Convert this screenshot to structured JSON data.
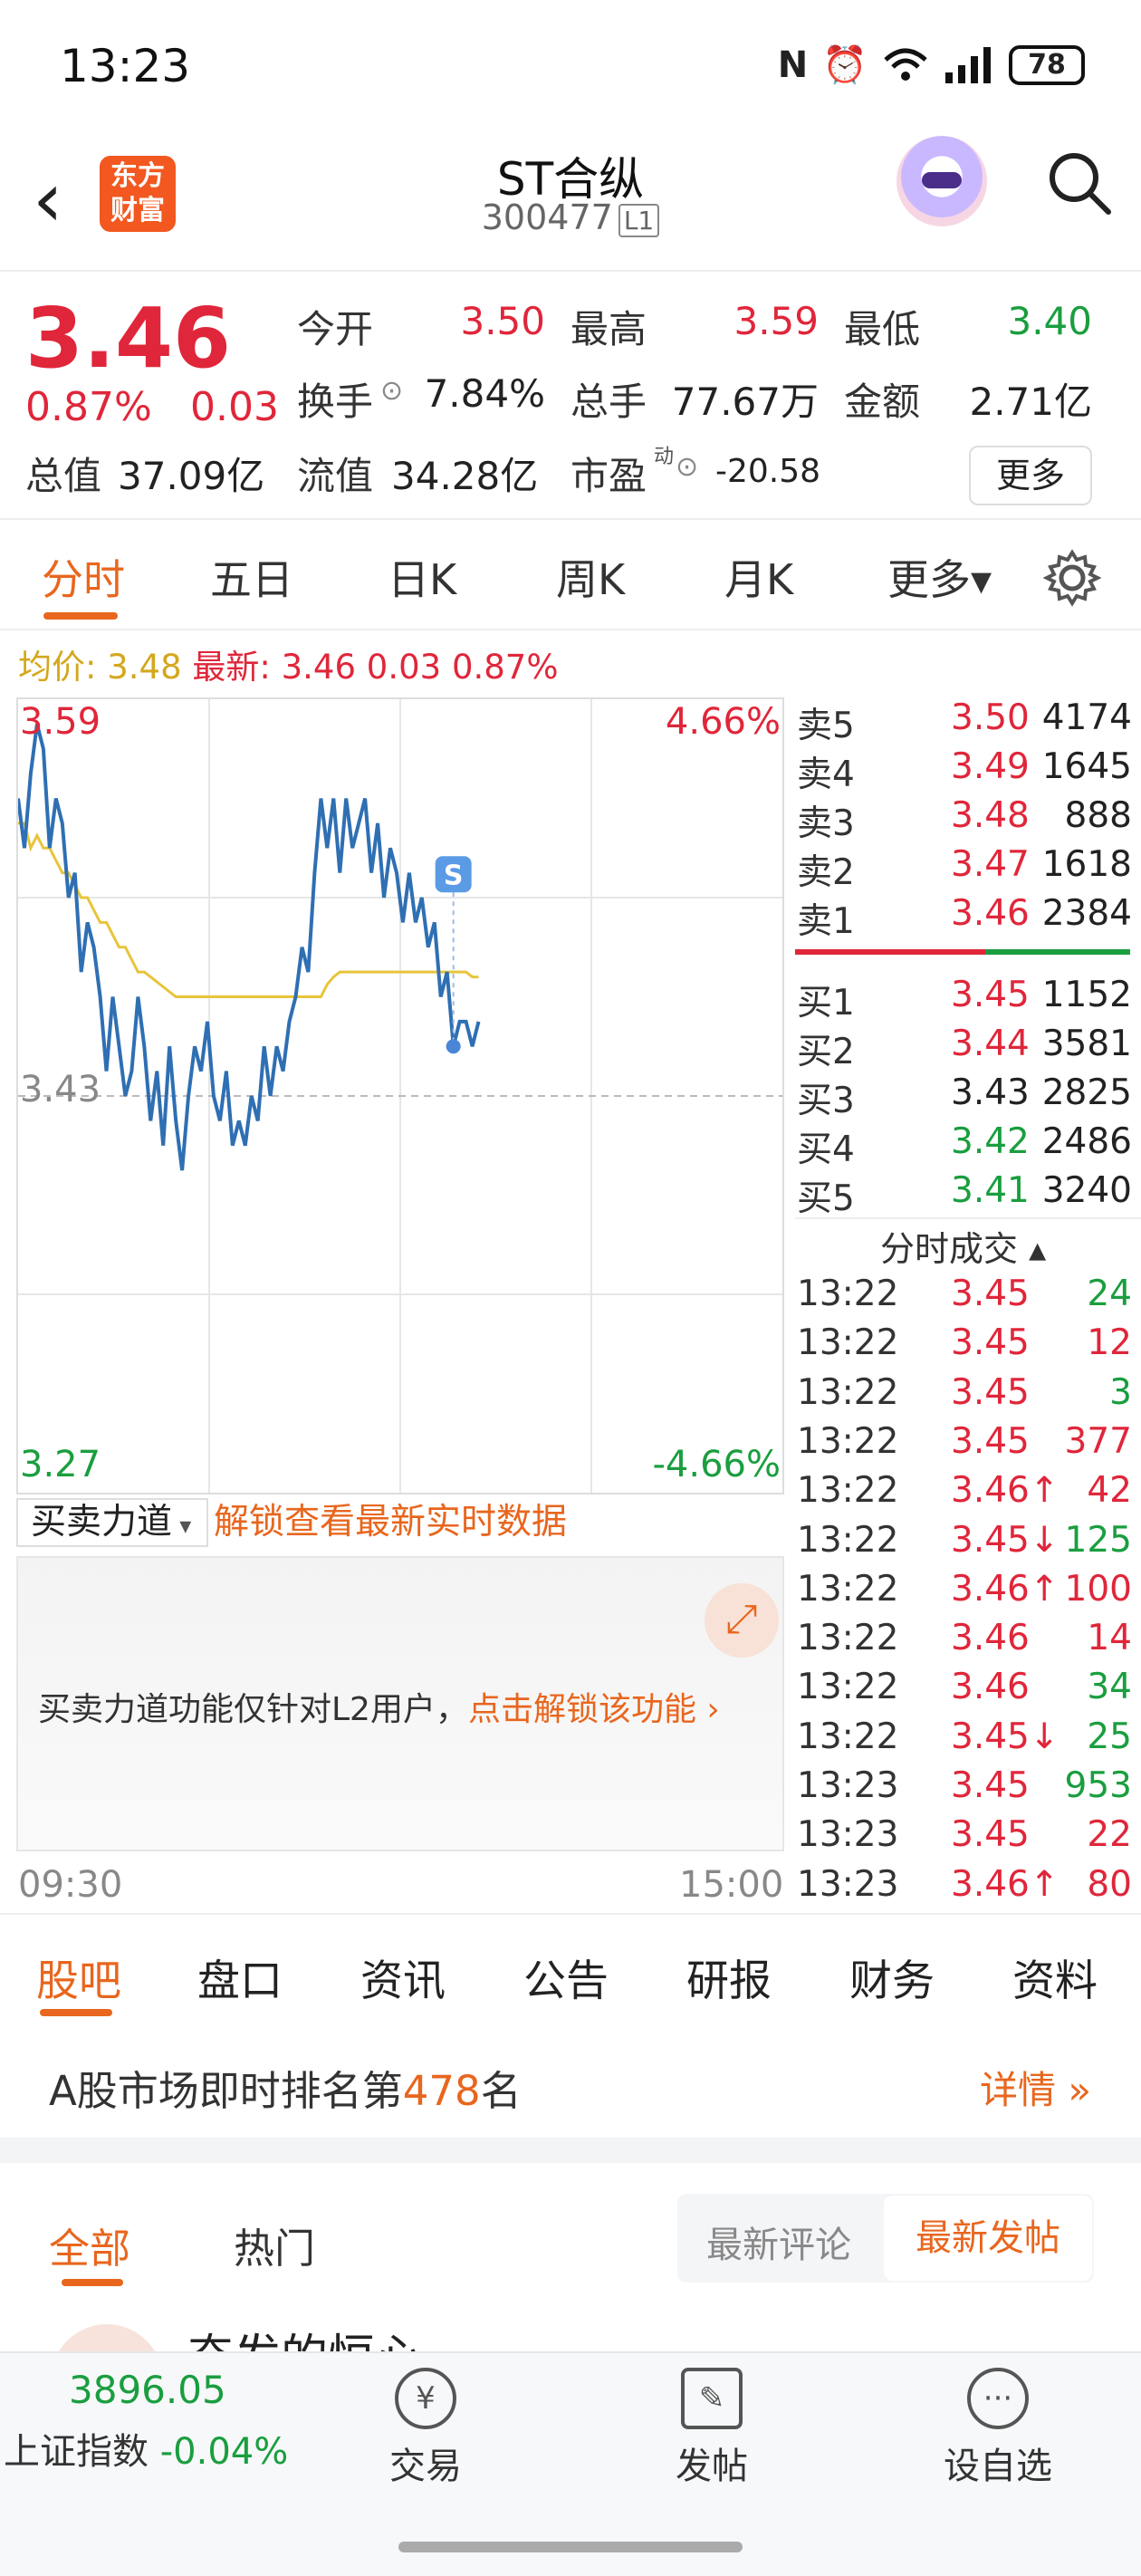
{
  "status_bar": {
    "time": "13:23",
    "battery": "78"
  },
  "header": {
    "title": "ST合纵",
    "code": "300477",
    "level": "L1",
    "logo_line1": "东方",
    "logo_line2": "财富"
  },
  "quote": {
    "price": "3.46",
    "pct": "0.87%",
    "chg": "0.03",
    "open_label": "今开",
    "open": "3.50",
    "high_label": "最高",
    "high": "3.59",
    "low_label": "最低",
    "low": "3.40",
    "turnover_label": "换手",
    "turnover": "7.84%",
    "volume_label": "总手",
    "volume": "77.67万",
    "amount_label": "金额",
    "amount": "2.71亿",
    "mktcap_label": "总值",
    "mktcap": "37.09亿",
    "float_label": "流值",
    "float": "34.28亿",
    "pe_label": "市盈",
    "pe_sup": "动",
    "pe": "-20.58",
    "more_button": "更多"
  },
  "chart_tabs": [
    "分时",
    "五日",
    "日K",
    "周K",
    "月K",
    "更多▾"
  ],
  "chart_info": {
    "avg_label": "均价:",
    "avg": "3.48",
    "last_label": "最新:",
    "last": "3.46",
    "last_chg": "0.03",
    "last_pct": "0.87%"
  },
  "chart_data": {
    "type": "line",
    "y_top": "3.59",
    "y_mid": "3.43",
    "y_bottom": "3.27",
    "pct_top": "4.66%",
    "pct_bottom": "-4.66%",
    "x_start": "09:30",
    "x_end": "15:00",
    "ylim": [
      3.27,
      3.59
    ],
    "prev_close": 3.43,
    "marker_label": "S",
    "series": [
      {
        "values": [
          3.55,
          3.53,
          3.56,
          3.58,
          3.57,
          3.53,
          3.55,
          3.54,
          3.51,
          3.52,
          3.48,
          3.5,
          3.49,
          3.47,
          3.44,
          3.47,
          3.45,
          3.43,
          3.44,
          3.47,
          3.45,
          3.42,
          3.44,
          3.41,
          3.45,
          3.42,
          3.4,
          3.43,
          3.45,
          3.44,
          3.46,
          3.43,
          3.42,
          3.44,
          3.41,
          3.42,
          3.41,
          3.43,
          3.42,
          3.45,
          3.43,
          3.45,
          3.44,
          3.46,
          3.47,
          3.49,
          3.48,
          3.52,
          3.55,
          3.53,
          3.55,
          3.52,
          3.55,
          3.53,
          3.54,
          3.55,
          3.52,
          3.54,
          3.51,
          3.53,
          3.52,
          3.5,
          3.52,
          3.5,
          3.51,
          3.49,
          3.5,
          3.47,
          3.48,
          3.45,
          3.46,
          3.46,
          3.45,
          3.46
        ]
      },
      {
        "values": [
          3.54,
          3.54,
          3.53,
          3.535,
          3.53,
          3.53,
          3.525,
          3.52,
          3.52,
          3.515,
          3.51,
          3.51,
          3.505,
          3.5,
          3.5,
          3.495,
          3.49,
          3.49,
          3.485,
          3.48,
          3.48,
          3.478,
          3.476,
          3.474,
          3.472,
          3.47,
          3.47,
          3.47,
          3.47,
          3.47,
          3.47,
          3.47,
          3.47,
          3.47,
          3.47,
          3.47,
          3.47,
          3.47,
          3.47,
          3.47,
          3.47,
          3.47,
          3.47,
          3.47,
          3.47,
          3.47,
          3.47,
          3.47,
          3.47,
          3.475,
          3.478,
          3.48,
          3.48,
          3.48,
          3.48,
          3.48,
          3.48,
          3.48,
          3.48,
          3.48,
          3.48,
          3.48,
          3.48,
          3.48,
          3.48,
          3.48,
          3.48,
          3.48,
          3.48,
          3.48,
          3.48,
          3.48,
          3.478,
          3.478
        ]
      }
    ]
  },
  "order_book": {
    "asks": [
      {
        "label": "卖5",
        "price": "3.50",
        "vol": "4174"
      },
      {
        "label": "卖4",
        "price": "3.49",
        "vol": "1645"
      },
      {
        "label": "卖3",
        "price": "3.48",
        "vol": "888"
      },
      {
        "label": "卖2",
        "price": "3.47",
        "vol": "1618"
      },
      {
        "label": "卖1",
        "price": "3.46",
        "vol": "2384"
      }
    ],
    "bids": [
      {
        "label": "买1",
        "price": "3.45",
        "vol": "1152"
      },
      {
        "label": "买2",
        "price": "3.44",
        "vol": "3581"
      },
      {
        "label": "买3",
        "price": "3.43",
        "vol": "2825"
      },
      {
        "label": "买4",
        "price": "3.42",
        "vol": "2486"
      },
      {
        "label": "买5",
        "price": "3.41",
        "vol": "3240"
      }
    ],
    "trades_title": "分时成交 ▴",
    "trades": [
      {
        "time": "13:22",
        "price": "3.45",
        "arrow": "",
        "vol": "24"
      },
      {
        "time": "13:22",
        "price": "3.45",
        "arrow": "",
        "vol": "12"
      },
      {
        "time": "13:22",
        "price": "3.45",
        "arrow": "",
        "vol": "3"
      },
      {
        "time": "13:22",
        "price": "3.45",
        "arrow": "",
        "vol": "377"
      },
      {
        "time": "13:22",
        "price": "3.46",
        "arrow": "↑",
        "vol": "42"
      },
      {
        "time": "13:22",
        "price": "3.45",
        "arrow": "↓",
        "vol": "125"
      },
      {
        "time": "13:22",
        "price": "3.46",
        "arrow": "↑",
        "vol": "100"
      },
      {
        "time": "13:22",
        "price": "3.46",
        "arrow": "",
        "vol": "14"
      },
      {
        "time": "13:22",
        "price": "3.46",
        "arrow": "",
        "vol": "34"
      },
      {
        "time": "13:22",
        "price": "3.45",
        "arrow": "↓",
        "vol": "25"
      },
      {
        "time": "13:23",
        "price": "3.45",
        "arrow": "",
        "vol": "953"
      },
      {
        "time": "13:23",
        "price": "3.45",
        "arrow": "",
        "vol": "22"
      },
      {
        "time": "13:23",
        "price": "3.46",
        "arrow": "↑",
        "vol": "80"
      }
    ]
  },
  "force": {
    "selector": "买卖力道",
    "unlock_link": "解锁查看最新实时数据",
    "message": "买卖力道功能仅针对L2用户，",
    "message_link": "点击解锁该功能 ›"
  },
  "bottom_tabs": [
    "股吧",
    "盘口",
    "资讯",
    "公告",
    "研报",
    "财务",
    "资料"
  ],
  "rank": {
    "prefix": "A股市场即时排名第",
    "number": "478",
    "suffix": "名",
    "detail": "详情 »"
  },
  "feed_tabs": {
    "all": "全部",
    "hot": "热门",
    "sort_comment": "最新评论",
    "sort_post": "最新发帖"
  },
  "post_peek": "奋发的恒心",
  "bottom_nav": {
    "index_value": "3896.05",
    "index_name": "上证指数",
    "index_chg": "-0.04%",
    "trade": "交易",
    "post": "发帖",
    "watch": "设自选"
  },
  "colors": {
    "up": "#e0263a",
    "down": "#1a9e3f",
    "accent": "#e8661e",
    "price_line": "#2f6fb3",
    "avg_line": "#e8c43a"
  }
}
